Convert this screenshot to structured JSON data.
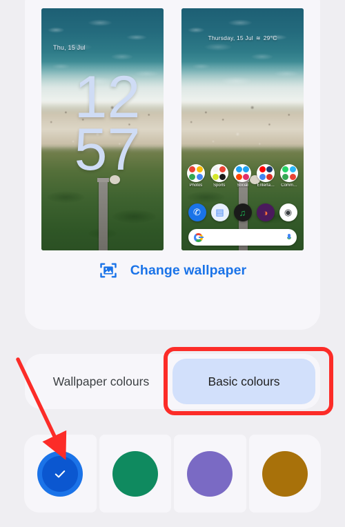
{
  "screen": {
    "background_color": "#efeef2",
    "card_color": "#f7f6fa"
  },
  "preview": {
    "lock_screen": {
      "date": "Thu, 15 Jul",
      "clock_hour": "12",
      "clock_minute": "57"
    },
    "home_screen": {
      "status_date": "Thursday, 15 Jul",
      "weather_glyph": "≋",
      "temperature": "29°C",
      "folders": [
        {
          "label": "Photos",
          "icon": "photos-folder-icon",
          "colors": [
            "#ea4335",
            "#fbbc05",
            "#34a853",
            "#4285f4"
          ]
        },
        {
          "label": "Sports",
          "icon": "sports-folder-icon",
          "colors": [
            "#f1f3f4",
            "#ea4335",
            "#d4e82a",
            "#1a1a1a"
          ]
        },
        {
          "label": "Social",
          "icon": "social-folder-icon",
          "colors": [
            "#1da1f2",
            "#1da1f2",
            "#ff4500",
            "#e1306c"
          ]
        },
        {
          "label": "Enterta…",
          "icon": "entertainment-folder-icon",
          "colors": [
            "#ff0000",
            "#1b3a6b",
            "#4285f4",
            "#d93025"
          ]
        },
        {
          "label": "Comm…",
          "icon": "communication-folder-icon",
          "colors": [
            "#25d366",
            "#29b6f6",
            "#34a853",
            "#ea4335"
          ]
        }
      ],
      "dock": [
        {
          "name": "phone-app-icon",
          "glyph": "✆",
          "bg": "#1a73e8",
          "fg": "#ffffff"
        },
        {
          "name": "messages-app-icon",
          "glyph": "▤",
          "bg": "#e8f0fe",
          "fg": "#4285f4"
        },
        {
          "name": "spotify-app-icon",
          "glyph": "♫",
          "bg": "#1a1a1a",
          "fg": "#1db954"
        },
        {
          "name": "firefox-app-icon",
          "glyph": "◑",
          "bg": "#4a1a5c",
          "fg": "#ff7139"
        },
        {
          "name": "camera-app-icon",
          "glyph": "◉",
          "bg": "#ffffff",
          "fg": "#3c4043"
        }
      ],
      "search_bar": {
        "leading_icon": "google-g-icon",
        "trailing_icon": "microphone-icon",
        "text": ""
      }
    }
  },
  "change_wallpaper": {
    "label": "Change wallpaper",
    "icon": "image-frame-icon",
    "color": "#1a73e8"
  },
  "tabs": {
    "items": [
      {
        "label": "Wallpaper colours",
        "active": false
      },
      {
        "label": "Basic colours",
        "active": true
      }
    ],
    "active_background": "#d2e0fb"
  },
  "swatches": {
    "items": [
      {
        "name": "blue-swatch",
        "color": "#1b73e8",
        "inner": "#0b57d0",
        "selected": true
      },
      {
        "name": "green-swatch",
        "color": "#0f8a5f",
        "inner": "#0f8a5f",
        "selected": false
      },
      {
        "name": "purple-swatch",
        "color": "#7a6ac4",
        "inner": "#7a6ac4",
        "selected": false
      },
      {
        "name": "amber-swatch",
        "color": "#a8710a",
        "inner": "#a8710a",
        "selected": false
      }
    ],
    "check_icon": "check-icon"
  },
  "annotations": {
    "highlight_color": "#fc2c28",
    "rectangle_target": "Basic colours",
    "arrow_target": "blue-swatch"
  }
}
